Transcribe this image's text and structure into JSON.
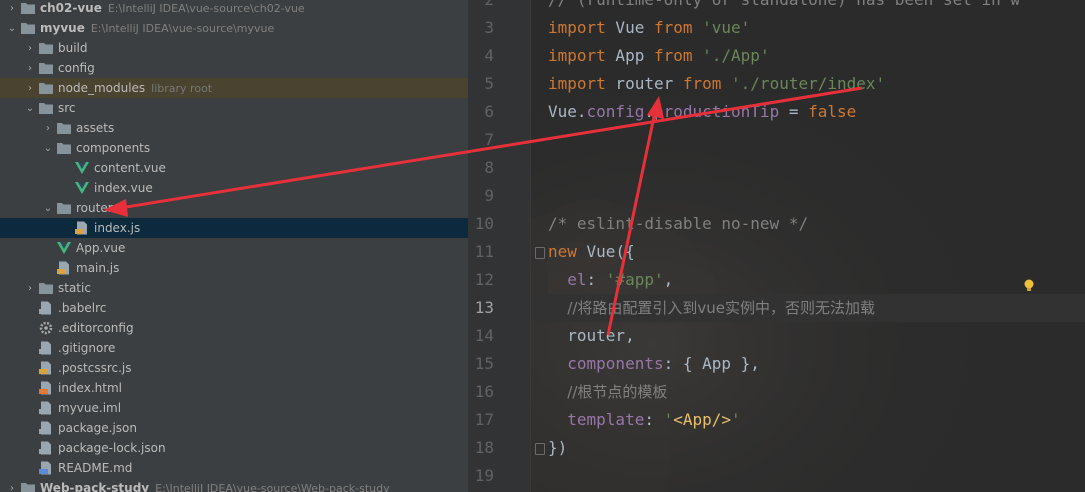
{
  "tree": {
    "rows": [
      {
        "name": "ch02-vue",
        "path": "E:\\IntelliJ IDEA\\vue-source\\ch02-vue",
        "icon": "folder-icon",
        "expanded": false
      },
      {
        "name": "myvue",
        "path": "E:\\IntelliJ IDEA\\vue-source\\myvue",
        "icon": "folder-icon",
        "expanded": true
      },
      {
        "name": "build",
        "icon": "folder-icon",
        "expanded": false
      },
      {
        "name": "config",
        "icon": "folder-icon",
        "expanded": false
      },
      {
        "name": "node_modules",
        "lib": "library root",
        "icon": "folder-icon",
        "expanded": false
      },
      {
        "name": "src",
        "icon": "folder-icon",
        "expanded": true
      },
      {
        "name": "assets",
        "icon": "folder-icon",
        "expanded": false
      },
      {
        "name": "components",
        "icon": "folder-icon",
        "expanded": true
      },
      {
        "name": "content.vue",
        "icon": "vue-file-icon"
      },
      {
        "name": "index.vue",
        "icon": "vue-file-icon"
      },
      {
        "name": "router",
        "icon": "folder-icon",
        "expanded": true
      },
      {
        "name": "index.js",
        "icon": "js-file-icon"
      },
      {
        "name": "App.vue",
        "icon": "vue-file-icon"
      },
      {
        "name": "main.js",
        "icon": "js-file-icon"
      },
      {
        "name": "static",
        "icon": "folder-icon",
        "expanded": false
      },
      {
        "name": ".babelrc",
        "icon": "babelrc-file-icon"
      },
      {
        "name": ".editorconfig",
        "icon": "gear-icon"
      },
      {
        "name": ".gitignore",
        "icon": "gitignore-file-icon"
      },
      {
        "name": ".postcssrc.js",
        "icon": "js-file-icon"
      },
      {
        "name": "index.html",
        "icon": "html-file-icon"
      },
      {
        "name": "myvue.iml",
        "icon": "iml-file-icon"
      },
      {
        "name": "package.json",
        "icon": "json-file-icon"
      },
      {
        "name": "package-lock.json",
        "icon": "json-file-icon"
      },
      {
        "name": "README.md",
        "icon": "markdown-file-icon"
      },
      {
        "name": "Web-pack-study",
        "path": "E:\\IntelliJ IDEA\\vue-source\\Web-pack-study",
        "icon": "folder-icon",
        "expanded": false
      }
    ]
  },
  "editor": {
    "current_line": "13",
    "line_numbers": [
      "2",
      "3",
      "4",
      "5",
      "6",
      "7",
      "8",
      "9",
      "10",
      "11",
      "12",
      "13",
      "14",
      "15",
      "16",
      "17",
      "18",
      "19"
    ],
    "lines": [
      [
        "// (runtime-only or standalone) has been set in w"
      ],
      [
        "import",
        " Vue ",
        "from",
        " ",
        "'vue'"
      ],
      [
        "import",
        " App ",
        "from",
        " ",
        "'./App'"
      ],
      [
        "import",
        " router ",
        "from",
        " ",
        "'./router/index'"
      ],
      [
        "Vue.",
        "config",
        ".",
        "productionTip",
        " = ",
        "false"
      ],
      [],
      [],
      [],
      [
        "/* eslint-disable no-new */"
      ],
      [
        "new",
        " Vue({"
      ],
      [
        "  ",
        "el",
        ": ",
        "'#app'",
        ","
      ],
      [
        "  ",
        "//将路由配置引入到vue实例中，否则无法加载"
      ],
      [
        "  router",
        ","
      ],
      [
        "  ",
        "components",
        ": { App },"
      ],
      [
        "  ",
        "//根节点的模板"
      ],
      [
        "  ",
        "template",
        ": ",
        "'",
        "<App/>",
        "'"
      ],
      [
        "})"
      ],
      []
    ]
  },
  "colors": {
    "keyword": "#cc7832",
    "string": "#6a8759",
    "property": "#9876aa",
    "comment": "#808080",
    "text": "#a9b7c6",
    "annotation_arrow": "#e8303a"
  }
}
